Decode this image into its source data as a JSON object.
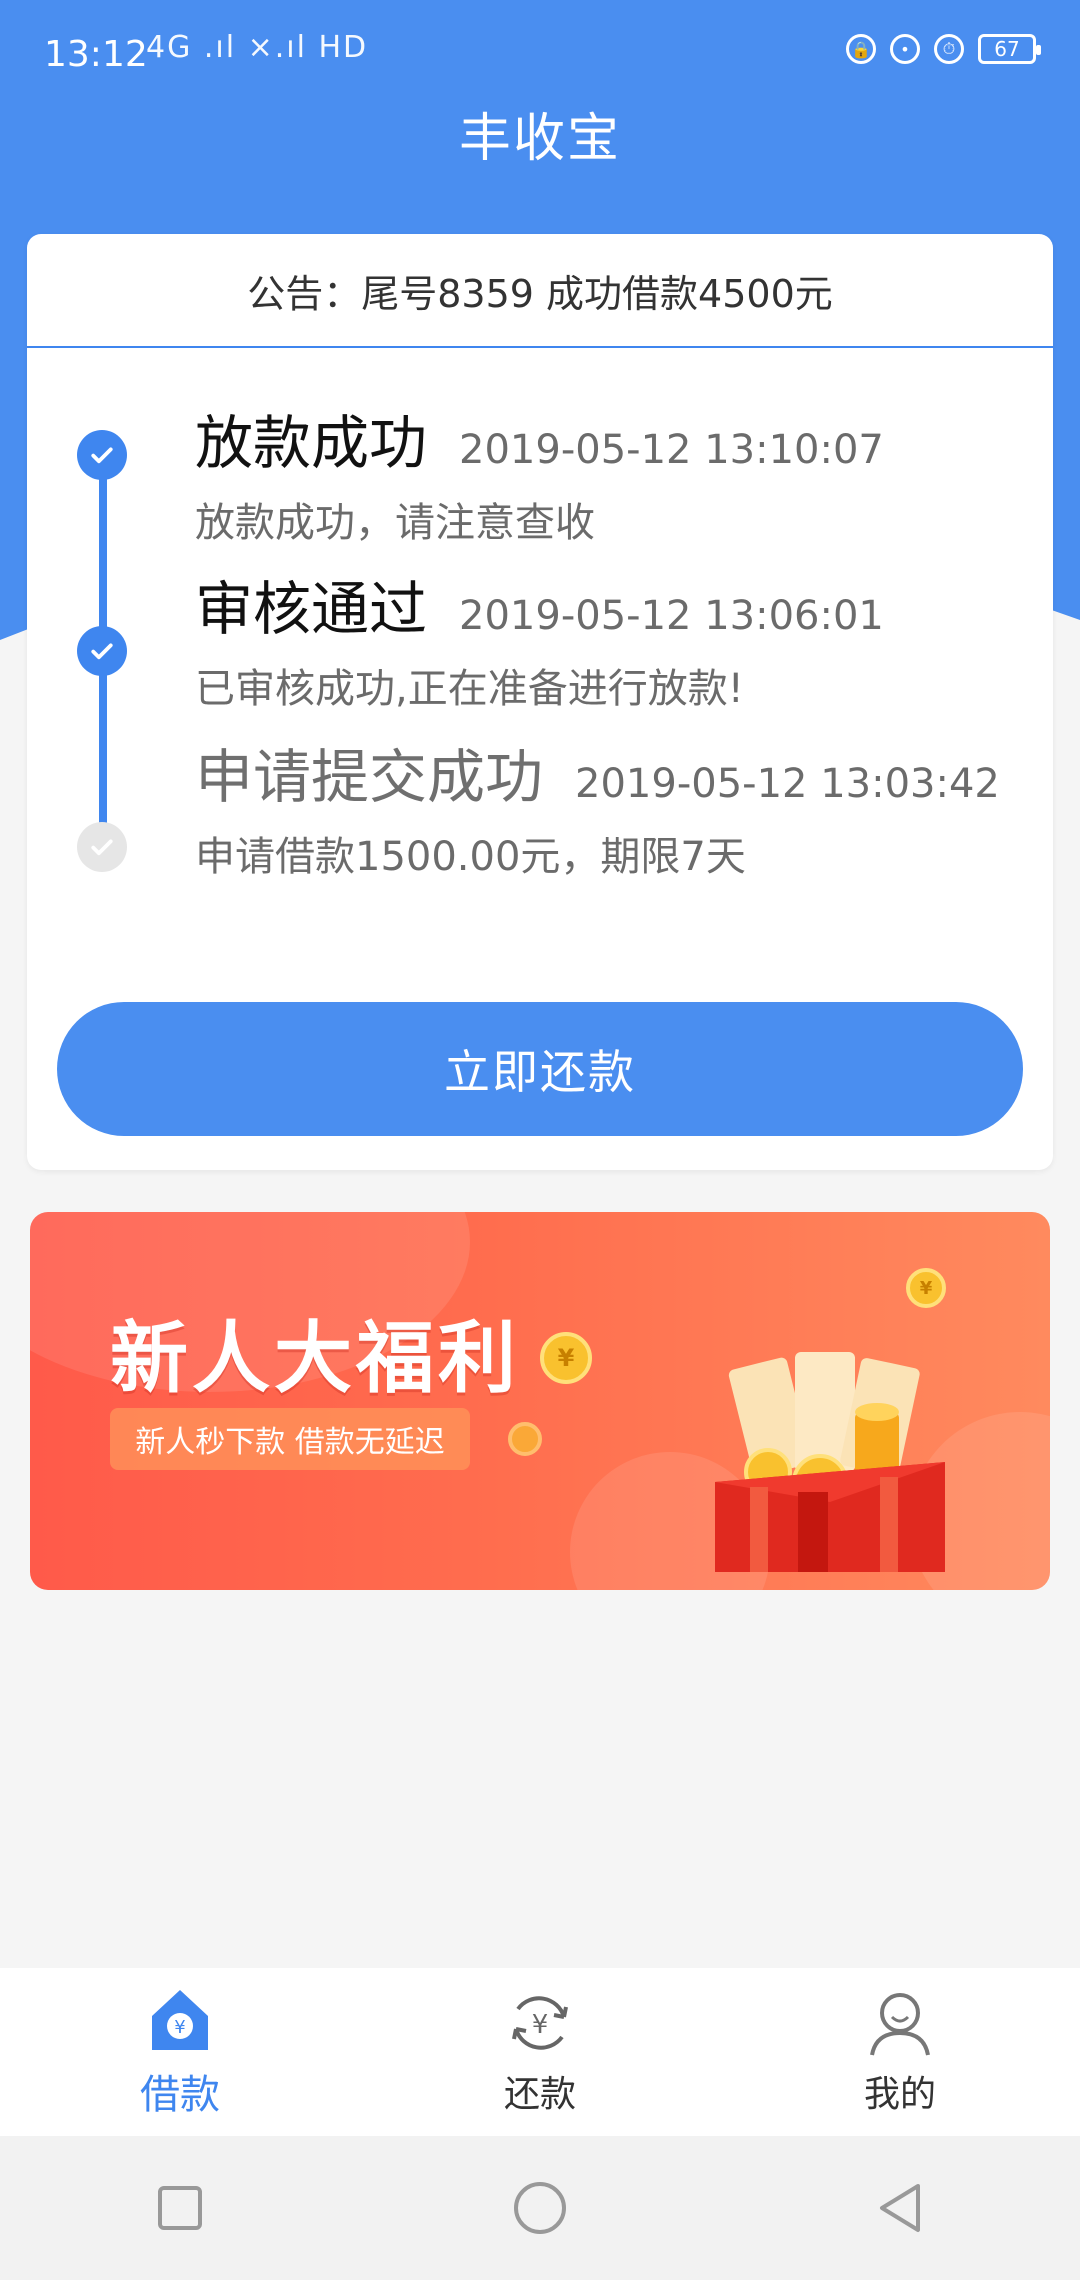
{
  "status_bar": {
    "time": "13:12",
    "signal_text": "4G .ıl ×.ıl  HD",
    "battery": "67"
  },
  "app": {
    "title": "丰收宝"
  },
  "notice": {
    "text": "公告：尾号8359 成功借款4500元"
  },
  "timeline": [
    {
      "title": "放款成功",
      "time": "2019-05-12 13:10:07",
      "desc": "放款成功，请注意查收",
      "done": true
    },
    {
      "title": "审核通过",
      "time": "2019-05-12 13:06:01",
      "desc": "已审核成功,正在准备进行放款!",
      "done": true
    },
    {
      "title": "申请提交成功",
      "time": "2019-05-12 13:03:42",
      "desc": "申请借款1500.00元，期限7天",
      "done": false
    }
  ],
  "repay_button": {
    "label": "立即还款"
  },
  "banner": {
    "title": "新人大福利",
    "subtitle": "新人秒下款  借款无延迟"
  },
  "tabs": [
    {
      "label": "借款",
      "icon": "home-yuan-icon",
      "active": true
    },
    {
      "label": "还款",
      "icon": "repay-yuan-icon",
      "active": false
    },
    {
      "label": "我的",
      "icon": "user-icon",
      "active": false
    }
  ],
  "colors": {
    "primary": "#4a8ef0",
    "banner": "#ff5a4a"
  }
}
